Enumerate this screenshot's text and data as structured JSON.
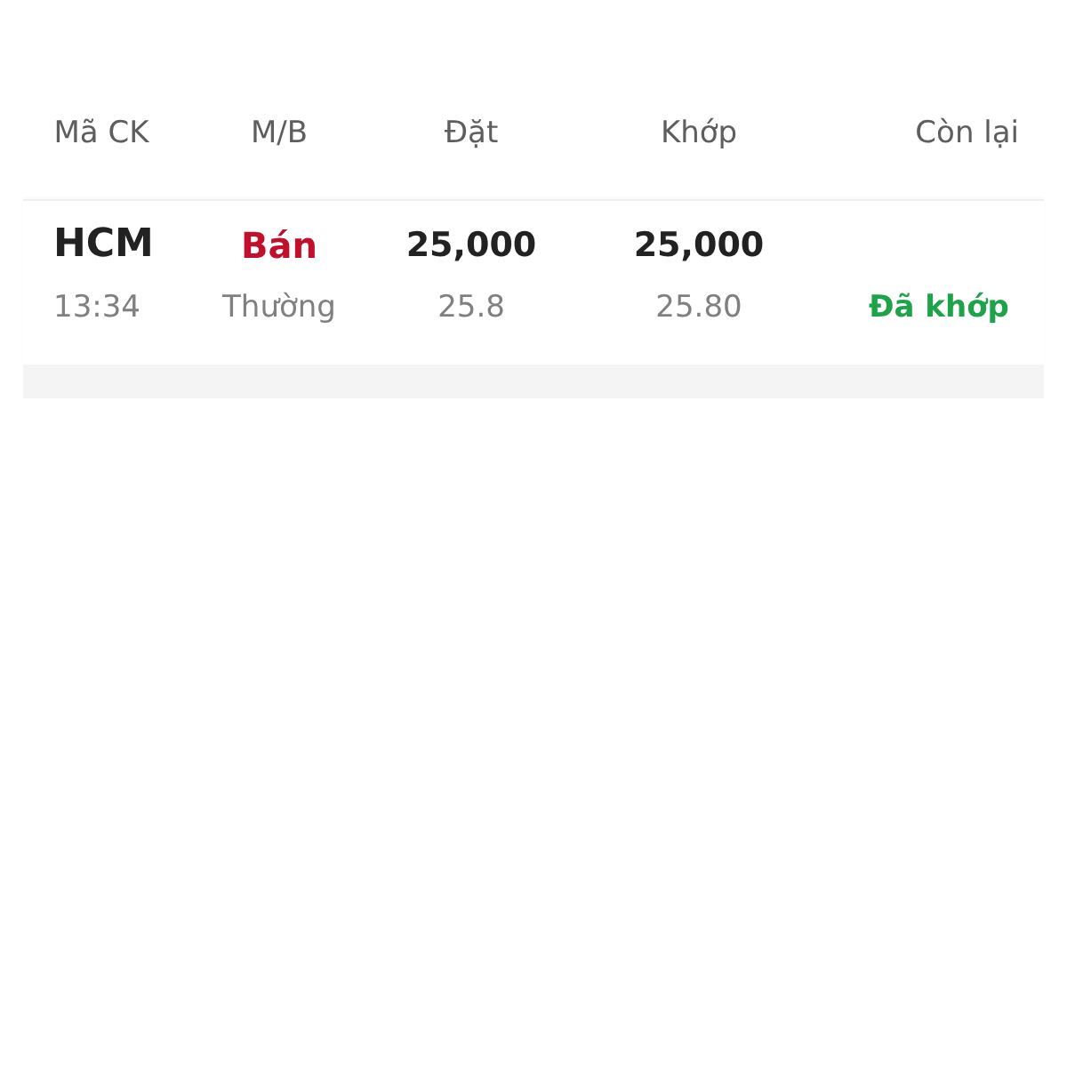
{
  "columns": [
    "Mã CK",
    "M/B",
    "Đặt",
    "Khớp",
    "Còn lại"
  ],
  "orders": [
    {
      "symbol": "HCM",
      "time": "13:34",
      "side": "Bán",
      "kind": "sell",
      "order_type": "Thường",
      "order_qty": "25,000",
      "order_price": "25.8",
      "matched_qty": "25,000",
      "matched_price": "25.80",
      "status": "Đã khớp",
      "filled": true
    }
  ]
}
